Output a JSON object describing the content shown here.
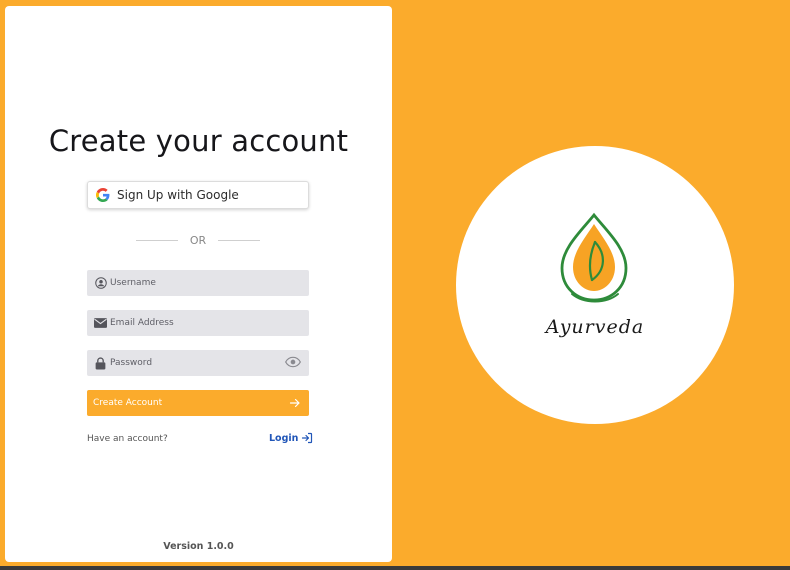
{
  "signup": {
    "title": "Create your account",
    "google_label": "Sign Up with Google",
    "or_text": "OR",
    "username_placeholder": "Username",
    "email_placeholder": "Email Address",
    "password_placeholder": "Password",
    "create_label": "Create Account",
    "have_account_text": "Have an account?",
    "login_label": "Login",
    "version": "Version 1.0.0"
  },
  "brand": {
    "name": "Ayurveda"
  },
  "colors": {
    "accent": "#FBAB2C",
    "link": "#2156B8",
    "field_bg": "#E4E4E8",
    "leaf_green": "#2E8B3A"
  }
}
